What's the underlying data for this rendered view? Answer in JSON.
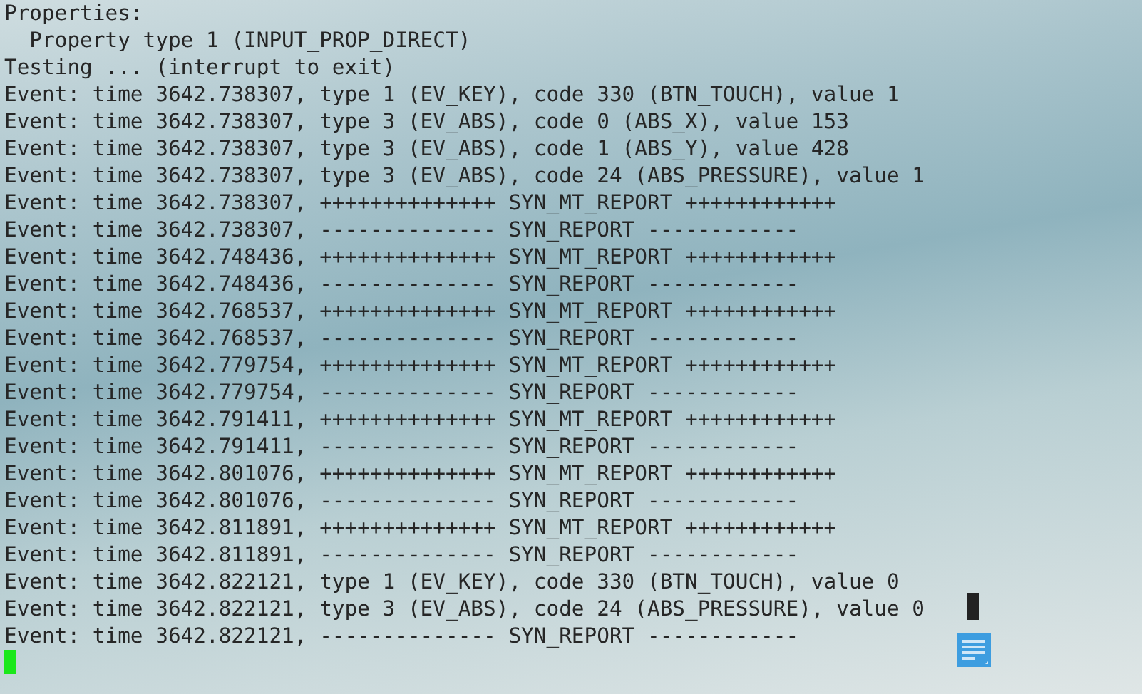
{
  "terminal": {
    "lines": [
      "Properties:",
      "  Property type 1 (INPUT_PROP_DIRECT)",
      "Testing ... (interrupt to exit)",
      "Event: time 3642.738307, type 1 (EV_KEY), code 330 (BTN_TOUCH), value 1",
      "Event: time 3642.738307, type 3 (EV_ABS), code 0 (ABS_X), value 153",
      "Event: time 3642.738307, type 3 (EV_ABS), code 1 (ABS_Y), value 428",
      "Event: time 3642.738307, type 3 (EV_ABS), code 24 (ABS_PRESSURE), value 1",
      "Event: time 3642.738307, ++++++++++++++ SYN_MT_REPORT ++++++++++++",
      "Event: time 3642.738307, -------------- SYN_REPORT ------------",
      "Event: time 3642.748436, ++++++++++++++ SYN_MT_REPORT ++++++++++++",
      "Event: time 3642.748436, -------------- SYN_REPORT ------------",
      "Event: time 3642.768537, ++++++++++++++ SYN_MT_REPORT ++++++++++++",
      "Event: time 3642.768537, -------------- SYN_REPORT ------------",
      "Event: time 3642.779754, ++++++++++++++ SYN_MT_REPORT ++++++++++++",
      "Event: time 3642.779754, -------------- SYN_REPORT ------------",
      "Event: time 3642.791411, ++++++++++++++ SYN_MT_REPORT ++++++++++++",
      "Event: time 3642.791411, -------------- SYN_REPORT ------------",
      "Event: time 3642.801076, ++++++++++++++ SYN_MT_REPORT ++++++++++++",
      "Event: time 3642.801076, -------------- SYN_REPORT ------------",
      "Event: time 3642.811891, ++++++++++++++ SYN_MT_REPORT ++++++++++++",
      "Event: time 3642.811891, -------------- SYN_REPORT ------------",
      "Event: time 3642.822121, type 1 (EV_KEY), code 330 (BTN_TOUCH), value 0",
      "Event: time 3642.822121, type 3 (EV_ABS), code 24 (ABS_PRESSURE), value 0",
      "Event: time 3642.822121, -------------- SYN_REPORT ------------"
    ]
  }
}
